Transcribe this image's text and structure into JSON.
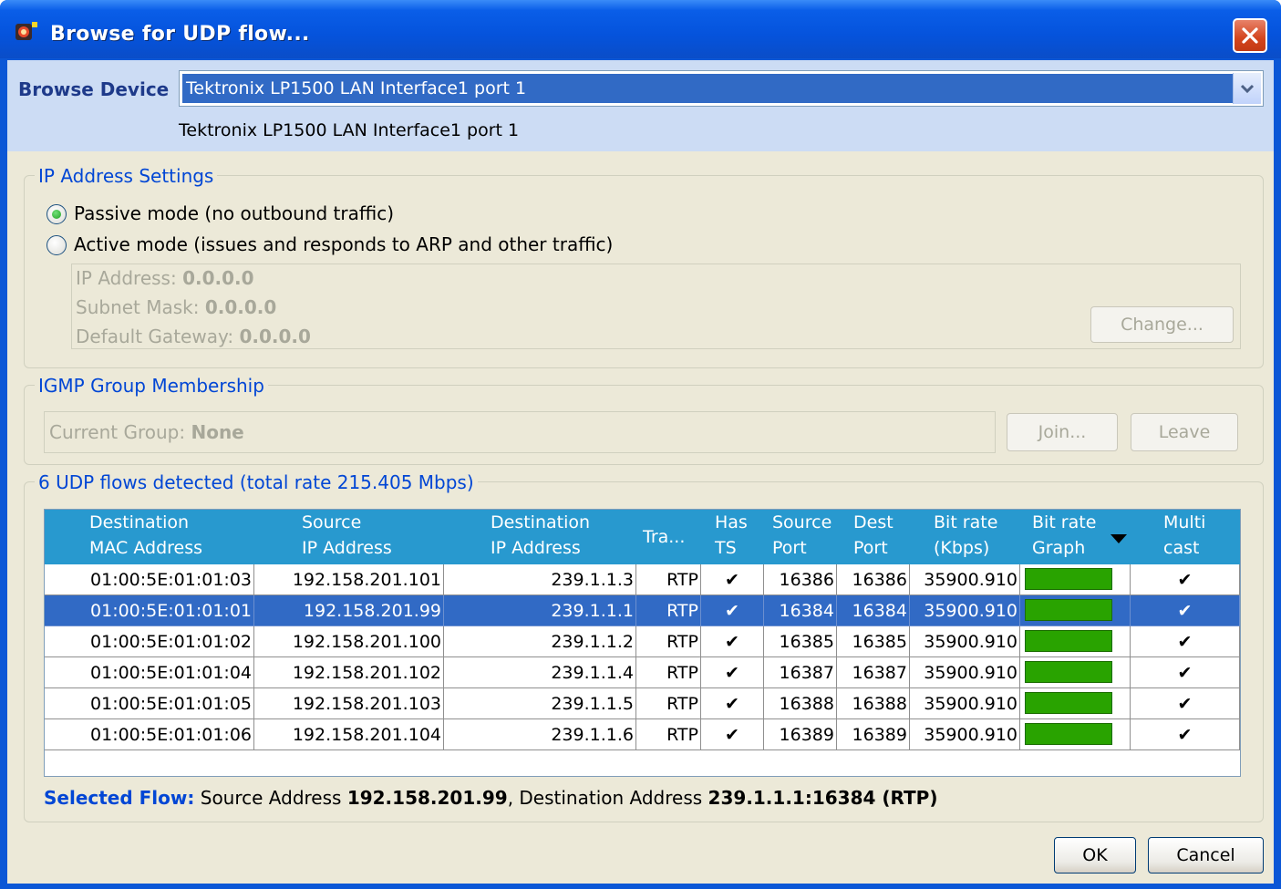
{
  "window": {
    "title": "Browse for UDP flow..."
  },
  "browse_device": {
    "label": "Browse Device",
    "selected": "Tektronix LP1500 LAN Interface1 port 1",
    "description": "Tektronix LP1500 LAN Interface1 port 1"
  },
  "ip_settings": {
    "legend": "IP Address Settings",
    "passive_label": "Passive mode (no outbound traffic)",
    "active_label": "Active mode (issues and responds to ARP and other traffic)",
    "selected_mode": "passive",
    "ip_address_label": "IP Address:",
    "ip_address_value": "0.0.0.0",
    "subnet_label": "Subnet Mask:",
    "subnet_value": "0.0.0.0",
    "gateway_label": "Default Gateway:",
    "gateway_value": "0.0.0.0",
    "change_button": "Change..."
  },
  "igmp": {
    "legend": "IGMP Group Membership",
    "current_group_label": "Current Group:",
    "current_group_value": "None",
    "join_button": "Join...",
    "leave_button": "Leave"
  },
  "flows": {
    "legend": "6 UDP flows detected (total rate 215.405 Mbps)",
    "columns": {
      "dest_mac": [
        "Destination",
        "MAC Address"
      ],
      "source_ip": [
        "Source",
        "IP Address"
      ],
      "dest_ip": [
        "Destination",
        "IP Address"
      ],
      "transport": [
        "Tra..."
      ],
      "has_ts": [
        "Has",
        "TS"
      ],
      "source_port": [
        "Source",
        "Port"
      ],
      "dest_port": [
        "Dest",
        "Port"
      ],
      "bit_rate": [
        "Bit rate",
        "(Kbps)"
      ],
      "bit_rate_graph": [
        "Bit rate",
        "Graph"
      ],
      "multicast": [
        "Multi",
        "cast"
      ]
    },
    "sort_indicator": "descending",
    "check_glyph": "✔",
    "rows": [
      {
        "dest_mac": "01:00:5E:01:01:03",
        "source_ip": "192.158.201.101",
        "dest_ip": "239.1.1.3",
        "transport": "RTP",
        "has_ts": true,
        "source_port": "16386",
        "dest_port": "16386",
        "bit_rate": "35900.910",
        "graph_fraction": 1.0,
        "multicast": true,
        "selected": false
      },
      {
        "dest_mac": "01:00:5E:01:01:01",
        "source_ip": "192.158.201.99",
        "dest_ip": "239.1.1.1",
        "transport": "RTP",
        "has_ts": true,
        "source_port": "16384",
        "dest_port": "16384",
        "bit_rate": "35900.910",
        "graph_fraction": 1.0,
        "multicast": true,
        "selected": true
      },
      {
        "dest_mac": "01:00:5E:01:01:02",
        "source_ip": "192.158.201.100",
        "dest_ip": "239.1.1.2",
        "transport": "RTP",
        "has_ts": true,
        "source_port": "16385",
        "dest_port": "16385",
        "bit_rate": "35900.910",
        "graph_fraction": 1.0,
        "multicast": true,
        "selected": false
      },
      {
        "dest_mac": "01:00:5E:01:01:04",
        "source_ip": "192.158.201.102",
        "dest_ip": "239.1.1.4",
        "transport": "RTP",
        "has_ts": true,
        "source_port": "16387",
        "dest_port": "16387",
        "bit_rate": "35900.910",
        "graph_fraction": 1.0,
        "multicast": true,
        "selected": false
      },
      {
        "dest_mac": "01:00:5E:01:01:05",
        "source_ip": "192.158.201.103",
        "dest_ip": "239.1.1.5",
        "transport": "RTP",
        "has_ts": true,
        "source_port": "16388",
        "dest_port": "16388",
        "bit_rate": "35900.910",
        "graph_fraction": 1.0,
        "multicast": true,
        "selected": false
      },
      {
        "dest_mac": "01:00:5E:01:01:06",
        "source_ip": "192.158.201.104",
        "dest_ip": "239.1.1.6",
        "transport": "RTP",
        "has_ts": true,
        "source_port": "16389",
        "dest_port": "16389",
        "bit_rate": "35900.910",
        "graph_fraction": 1.0,
        "multicast": true,
        "selected": false
      }
    ]
  },
  "selected_flow": {
    "label": "Selected Flow:",
    "source_prefix": "Source Address",
    "source_value": "192.158.201.99",
    "separator": ",",
    "dest_prefix": "Destination Address",
    "dest_value": "239.1.1.1:16384 (RTP)"
  },
  "buttons": {
    "ok": "OK",
    "cancel": "Cancel"
  },
  "colors": {
    "title_bar": "#0553dc",
    "header_blue": "#2899cf",
    "selection_blue": "#316ac5",
    "graph_green": "#29a300",
    "link_blue": "#0046d5"
  },
  "icons": [
    "app-icon",
    "close-icon",
    "dropdown-arrow-icon",
    "sort-desc-icon",
    "check-icon"
  ]
}
